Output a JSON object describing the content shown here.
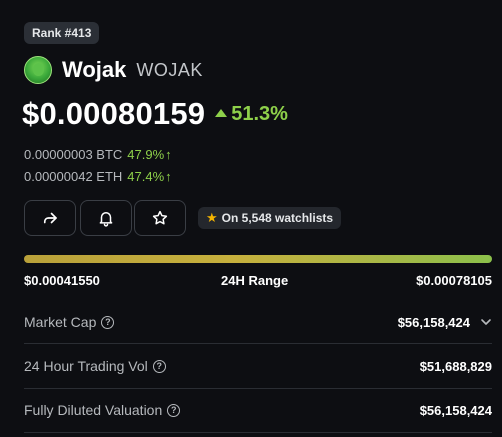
{
  "rank_badge": "Rank #413",
  "coin": {
    "name": "Wojak",
    "symbol": "WOJAK",
    "logo_icon": "wojak-logo-icon"
  },
  "price": {
    "value": "$0.00080159",
    "change": "51.3%",
    "change_direction": "up",
    "positive_color": "#8ed04a"
  },
  "conversions": [
    {
      "amount": "0.00000003 BTC",
      "change": "47.9%",
      "arrow": "↑"
    },
    {
      "amount": "0.00000042 ETH",
      "change": "47.4%",
      "arrow": "↑"
    }
  ],
  "actions": {
    "share_icon": "share-icon",
    "alert_icon": "bell-icon",
    "watchlist_icon": "star-icon"
  },
  "watchlist_badge": "On 5,548 watchlists",
  "range": {
    "low": "$0.00041550",
    "label": "24H Range",
    "high": "$0.00078105"
  },
  "stats": [
    {
      "label": "Market Cap",
      "value": "$56,158,424",
      "expandable": true
    },
    {
      "label": "24 Hour Trading Vol",
      "value": "$51,688,829",
      "expandable": false
    },
    {
      "label": "Fully Diluted Valuation",
      "value": "$56,158,424",
      "expandable": false
    }
  ]
}
